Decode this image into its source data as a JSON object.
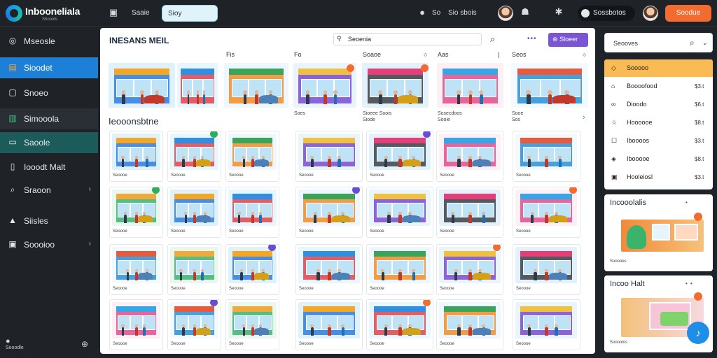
{
  "app": {
    "logo_text": "Inbooneliala",
    "logo_sub": "Shoools"
  },
  "topbar": {
    "menu_icon": "window-icon",
    "nav_text": "Saaie",
    "search_value": "Sioy",
    "status_text": "So",
    "status_text2": "Sio sbois",
    "user_name": "Sossbotos",
    "cta_label": "Soodue"
  },
  "sidebar": {
    "items": [
      {
        "label": "Mseosle",
        "icon": "dashboard-icon"
      },
      {
        "label": "Sioodet",
        "icon": "store-icon"
      },
      {
        "label": "Snoeo",
        "icon": "box-icon"
      },
      {
        "label": "Simooola",
        "icon": "building-icon"
      },
      {
        "label": "Saoole",
        "icon": "card-icon"
      },
      {
        "label": "Iooodt Malt",
        "icon": "tablet-icon"
      },
      {
        "label": "Sraoon",
        "icon": "search-icon"
      },
      {
        "label": "Siisles",
        "icon": "chart-icon"
      },
      {
        "label": "Soooioo",
        "icon": "bag-icon"
      }
    ],
    "footer": "Sooodle"
  },
  "main": {
    "title": "INESANS MEIL",
    "search_value": "Seoenia",
    "button_label": "Sloeer",
    "columns": [
      "Fis",
      "Fo",
      "Soaoe",
      "Aas",
      "Seos"
    ],
    "hero_captions": [
      "Soes",
      "Sioeee Soois",
      "Siode",
      "Sosecdoos",
      "Sooie",
      "Sooe",
      "Sos"
    ],
    "section_title": "Ieooonsbtne",
    "tile_caption": "Seoooe"
  },
  "right": {
    "search_placeholder": "Seooves",
    "list": [
      {
        "label": "Sooooo",
        "value": "",
        "icon": "tag-icon"
      },
      {
        "label": "Boooofood",
        "value": "$3.t",
        "icon": "gift-icon"
      },
      {
        "label": "Dioodo",
        "value": "$6.t",
        "icon": "link-icon"
      },
      {
        "label": "Hoooooe",
        "value": "$8.t",
        "icon": "star-icon"
      },
      {
        "label": "Iboooos",
        "value": "$3.t",
        "icon": "user-icon"
      },
      {
        "label": "Ibooooe",
        "value": "$8.t",
        "icon": "shield-icon"
      },
      {
        "label": "Hooleiosl",
        "value": "$3.t",
        "icon": "calendar-icon"
      }
    ],
    "card1": {
      "title": "Incooolalis",
      "dots": "•",
      "caption": "Sooooes"
    },
    "card2": {
      "title": "Incoo Halt",
      "dots": "• •",
      "caption": "Soooolos"
    }
  },
  "colors": {
    "accent": "#1e7fd6",
    "purple": "#7b55d6",
    "orange": "#f26b2f",
    "highlight": "#fbbb54"
  }
}
